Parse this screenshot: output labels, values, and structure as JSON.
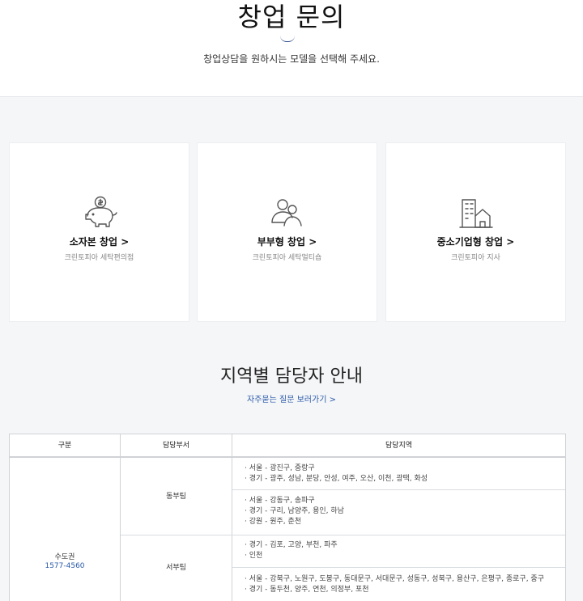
{
  "header": {
    "title": "창업 문의",
    "subtitle": "창업상담을 원하시는 모델을 선택해 주세요."
  },
  "cards": [
    {
      "title": "소자본 창업 >",
      "sub": "크린토피아 세탁편의점",
      "icon": "piggy-bank-icon"
    },
    {
      "title": "부부형 창업 >",
      "sub": "크린토피아 세탁멀티숍",
      "icon": "couple-icon"
    },
    {
      "title": "중소기업형 창업 >",
      "sub": "크린토피아 지사",
      "icon": "building-icon"
    }
  ],
  "regions": {
    "title": "지역별 담당자 안내",
    "faq_link": "자주묻는 질문 보러가기 >"
  },
  "table": {
    "headers": [
      "구분",
      "담당부서",
      "담당지역"
    ],
    "region_name": "수도권",
    "region_phone": "1577-4560",
    "teams": [
      {
        "name": "동부팀",
        "groups": [
          [
            "· 서울 - 광진구, 중랑구",
            "· 경기 - 광주, 성남, 분당, 안성, 여주, 오산, 이천, 광택, 화성"
          ],
          [
            "· 서울 - 강동구, 송파구",
            "· 경기 - 구리, 남양주, 용인, 하남",
            "· 강원 - 원주, 춘천"
          ]
        ]
      },
      {
        "name": "서부팀",
        "groups": [
          [
            "· 경기 - 김포, 고양, 부천, 파주",
            "· 인천"
          ],
          [
            "· 서울 - 강북구, 노원구, 도봉구, 동대문구, 서대문구, 성동구, 성북구, 용산구, 은평구, 종로구, 중구",
            "· 경기 - 동두천, 양주, 연천, 의정부, 포천"
          ]
        ]
      }
    ]
  },
  "colors": {
    "accent": "#2a5aa8",
    "background": "#f5f6f8",
    "icon": "#555555"
  }
}
